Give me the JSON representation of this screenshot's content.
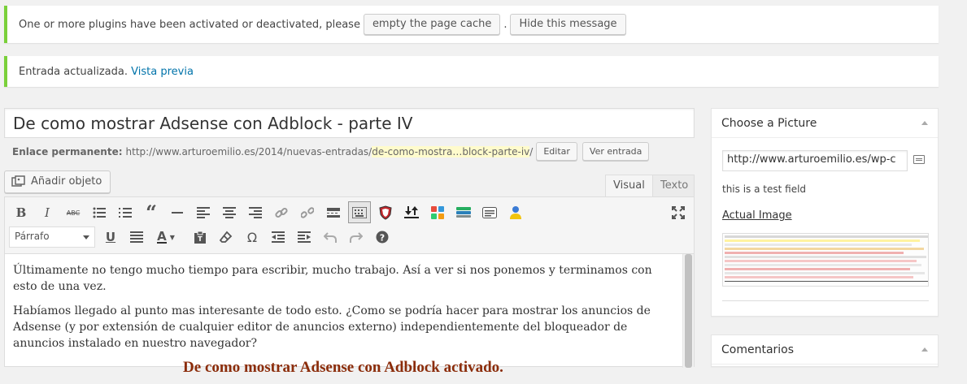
{
  "notices": {
    "cache": {
      "text": "One or more plugins have been activated or deactivated, please",
      "empty_cache_label": "empty the page cache",
      "separator": ".",
      "hide_label": "Hide this message"
    },
    "updated": {
      "text": "Entrada actualizada.",
      "preview_link": "Vista previa"
    }
  },
  "post": {
    "title": "De como mostrar Adsense con Adblock - parte IV",
    "permalink": {
      "label": "Enlace permanente:",
      "base": "http://www.arturoemilio.es/2014/nuevas-entradas/",
      "slug": "de-como-mostra…block-parte-iv",
      "trailing": "/",
      "edit_label": "Editar",
      "view_label": "Ver entrada"
    }
  },
  "editor": {
    "add_media_label": "Añadir objeto",
    "tabs": {
      "visual": "Visual",
      "text": "Texto"
    },
    "format_select": "Párrafo",
    "content": {
      "p1": "Últimamente no tengo mucho tiempo para escribir, mucho trabajo. Así a ver si nos ponemos y terminamos con esto de una vez.",
      "p2": "Habíamos llegado al punto mas interesante de todo esto. ¿Como se podría hacer para mostrar los anuncios de Adsense (y por extensión de cualquier editor de anuncios externo) independientemente del bloqueador de anuncios instalado en nuestro navegador?",
      "h2": "De como mostrar Adsense con Adblock activado."
    },
    "toolbar_row1": [
      "bold-icon",
      "italic-icon",
      "strikethrough-icon",
      "bullet-list-icon",
      "numbered-list-icon",
      "blockquote-icon",
      "horizontal-rule-icon",
      "align-left-icon",
      "align-center-icon",
      "align-right-icon",
      "insert-link-icon",
      "unlink-icon",
      "read-more-icon",
      "toolbar-toggle-icon",
      "shield-plugin-icon",
      "download-plugin-icon",
      "grid-plugin-icon",
      "stack-plugin-icon",
      "form-plugin-icon",
      "user-plugin-icon",
      "fullscreen-icon"
    ],
    "toolbar_row2": [
      "underline-icon",
      "justify-icon",
      "text-color-icon",
      "paste-text-icon",
      "clear-format-icon",
      "special-char-icon",
      "outdent-icon",
      "indent-icon",
      "undo-icon",
      "redo-icon",
      "help-icon"
    ]
  },
  "sidebar": {
    "picture_box": {
      "title": "Choose a Picture",
      "url_value": "http://www.arturoemilio.es/wp-c",
      "test_text": "this is a test field",
      "actual_image_label": "Actual Image"
    },
    "comments_box": {
      "title": "Comentarios"
    }
  },
  "colors": {
    "accent_link": "#0073aa",
    "notice_border": "#7ad03a",
    "heading_red": "#8b2c0a"
  }
}
